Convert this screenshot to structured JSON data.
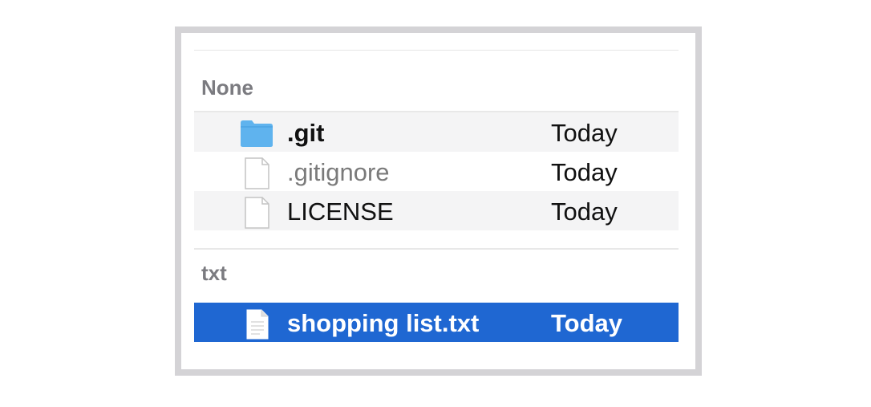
{
  "groups": [
    {
      "header": "None",
      "items": [
        {
          "name": ".git",
          "date": "Today",
          "icon": "folder-icon"
        },
        {
          "name": ".gitignore",
          "date": "Today",
          "icon": "document-icon"
        },
        {
          "name": "LICENSE",
          "date": "Today",
          "icon": "document-icon"
        }
      ]
    },
    {
      "header": "txt",
      "items": [
        {
          "name": "shopping list.txt",
          "date": "Today",
          "icon": "document-icon",
          "selected": true
        }
      ]
    }
  ],
  "colors": {
    "selection": "#1f67d2",
    "folder": "#5fb3ee",
    "header_text": "#7b7b80"
  }
}
